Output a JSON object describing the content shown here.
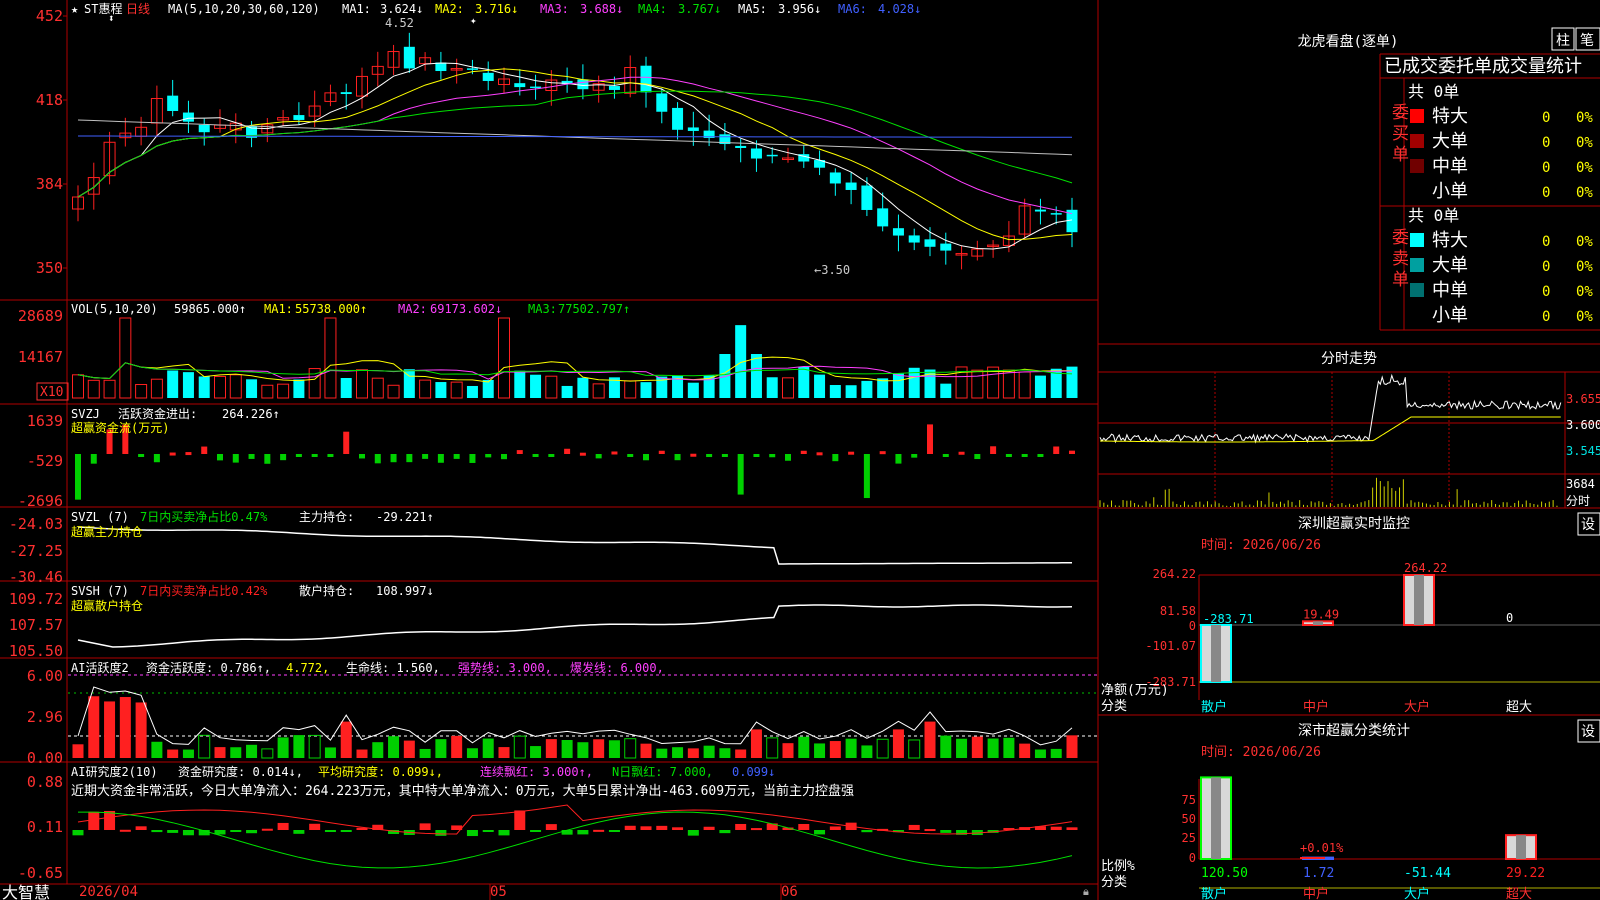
{
  "stock": {
    "name": "ST惠程",
    "period": "日线",
    "star": "★"
  },
  "colors": {
    "up": "#ff2020",
    "down": "#00ffff",
    "bg": "#000000",
    "frame": "#c00000",
    "ma1": "#ffffff",
    "ma2": "#ffff00",
    "ma3": "#ff40ff",
    "ma4": "#00e000",
    "ma5": "#c0c0c0",
    "ma6": "#4060ff"
  },
  "main": {
    "indicator": "MA(5,10,20,30,60,120)",
    "items": [
      {
        "label": "MA1:",
        "value": "3.624↓",
        "color": "#ffffff"
      },
      {
        "label": "MA2:",
        "value": "3.716↓",
        "color": "#ffff00"
      },
      {
        "label": "MA3:",
        "value": "3.688↓",
        "color": "#ff40ff"
      },
      {
        "label": "MA4:",
        "value": "3.767↓",
        "color": "#00e000"
      },
      {
        "label": "MA5:",
        "value": "3.956↓",
        "color": "#c0c0c0"
      },
      {
        "label": "MA6:",
        "value": "4.028↓",
        "color": "#4060ff"
      }
    ],
    "y_ticks": [
      "452",
      "418",
      "384",
      "350"
    ],
    "high_label": "4.52",
    "low_label": "←3.50"
  },
  "vol": {
    "indicator": "VOL(5,10,20)",
    "value": "59865.000↑",
    "items": [
      {
        "label": "MA1:",
        "value": "55738.000↑",
        "color": "#ffff00"
      },
      {
        "label": "MA2:",
        "value": "69173.602↓",
        "color": "#ff40ff"
      },
      {
        "label": "MA3:",
        "value": "77502.797↑",
        "color": "#00e000"
      }
    ],
    "y_ticks": [
      "28689",
      "14167"
    ],
    "unit": "X10"
  },
  "svzj": {
    "name": "SVZJ",
    "label": "活跃资金进出:",
    "value": "264.226↑",
    "sub": "超赢资金流(万元)",
    "y_ticks": [
      "1639",
      "-529",
      "-2696"
    ]
  },
  "svzl": {
    "name": "SVZL (7)",
    "label": "7日内买卖净占比0.47%",
    "label2": "主力持仓:",
    "value": "-29.221↑",
    "sub": "超赢主力持仓",
    "y_ticks": [
      "-24.03",
      "-27.25",
      "-30.46"
    ]
  },
  "svsh": {
    "name": "SVSH (7)",
    "label": "7日内买卖净占比0.42%",
    "label2": "散户持仓:",
    "value": "108.997↓",
    "sub": "超赢散户持仓",
    "y_ticks": [
      "109.72",
      "107.57",
      "105.50"
    ]
  },
  "ai1": {
    "name": "AI活跃度2",
    "items": [
      {
        "text": "资金活跃度: 0.786↑,",
        "color": "#ffffff"
      },
      {
        "text": "4.772,",
        "color": "#ffff00"
      },
      {
        "text": "生命线: 1.560,",
        "color": "#ffffff"
      },
      {
        "text": "强势线: 3.000,",
        "color": "#ff40ff"
      },
      {
        "text": "爆发线: 6.000,",
        "color": "#ff40ff"
      }
    ],
    "y_ticks": [
      "6.00",
      "2.96",
      "0.00"
    ]
  },
  "ai2": {
    "name": "AI研究度2(10)",
    "items": [
      {
        "text": "资金研究度: 0.014↓,",
        "color": "#ffffff"
      },
      {
        "text": "平均研究度: 0.099↓,",
        "color": "#ffff00"
      },
      {
        "text": "连续飘红: 3.000↑,",
        "color": "#ff40ff"
      },
      {
        "text": "N日飘红: 7.000,",
        "color": "#00e000"
      },
      {
        "text": "0.099↓",
        "color": "#4060ff"
      }
    ],
    "summary": "近期大资金非常活跃，今日大单净流入：264.223万元，其中特大单净流入：0万元，大单5日累计净出-463.609万元，当前主力控盘强",
    "y_ticks": [
      "0.88",
      "0.11",
      "-0.65"
    ]
  },
  "bottom": {
    "brand": "大智慧",
    "dates": [
      "2026/04",
      "05",
      "06"
    ]
  },
  "right": {
    "title": "龙虎看盘(逐单)",
    "tabs": [
      "柱",
      "笔"
    ],
    "subtitle": "已成交委托单成交量统计",
    "buy": {
      "side": "委买单",
      "total": "共 0单",
      "rows": [
        {
          "name": "特大",
          "count": "0",
          "pct": "0%",
          "color": "#ff0000"
        },
        {
          "name": "大单",
          "count": "0",
          "pct": "0%",
          "color": "#a00000"
        },
        {
          "name": "中单",
          "count": "0",
          "pct": "0%",
          "color": "#700000"
        },
        {
          "name": "小单",
          "count": "0",
          "pct": "0%",
          "color": "#000000"
        }
      ]
    },
    "sell": {
      "side": "委卖单",
      "total": "共 0单",
      "rows": [
        {
          "name": "特大",
          "count": "0",
          "pct": "0%",
          "color": "#00ffff"
        },
        {
          "name": "大单",
          "count": "0",
          "pct": "0%",
          "color": "#00a0a0"
        },
        {
          "name": "中单",
          "count": "0",
          "pct": "0%",
          "color": "#007070"
        },
        {
          "name": "小单",
          "count": "0",
          "pct": "0%",
          "color": "#000000"
        }
      ]
    },
    "intraday": {
      "title": "分时走势",
      "prices": [
        "3.655",
        "3.600",
        "3.545"
      ],
      "vol": "3684",
      "vol_unit": "分时"
    },
    "sz_monitor": {
      "title": "深圳超赢实时监控",
      "settings": "设",
      "date": "时间: 2026/06/26",
      "y_ticks": [
        "264.22",
        "81.58",
        "0",
        "-101.07",
        "-283.71"
      ],
      "net_label": "净额(万元)",
      "cat_label": "分类",
      "categories": [
        "散户",
        "中户",
        "大户",
        "超大"
      ],
      "values": [
        "-283.71",
        "19.49",
        "264.22",
        "0"
      ]
    },
    "cls_stats": {
      "title": "深市超赢分类统计",
      "settings": "设",
      "date": "时间: 2026/06/26",
      "y_ticks": [
        "75",
        "50",
        "25",
        "0"
      ],
      "ratio_label": "比例%",
      "cat_label": "分类",
      "categories": [
        "散户",
        "中户",
        "大户",
        "超大"
      ],
      "values": [
        "120.50",
        "1.72",
        "-51.44",
        "29.22"
      ],
      "annotation": "+0.01%"
    }
  }
}
